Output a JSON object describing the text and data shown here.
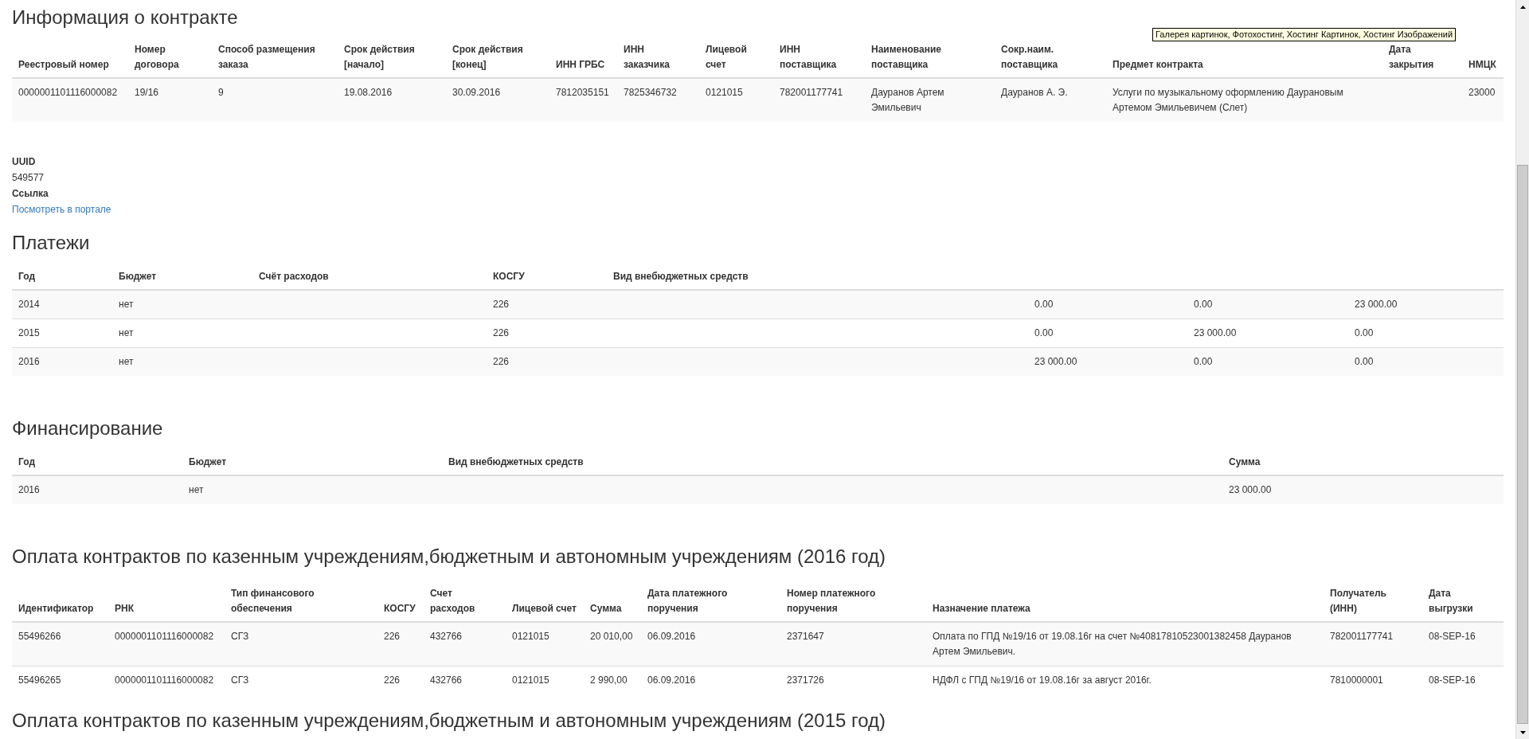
{
  "tooltip": {
    "text": "Галерея картинок, Фотохостинг, Хостинг Картинок, Хостинг Изображений"
  },
  "contract": {
    "title": "Информация о контракте",
    "columns": [
      "Реестровый номер",
      "Номер договора",
      "Способ размещения заказа",
      "Срок действия [начало]",
      "Срок действия [конец]",
      "ИНН ГРБС",
      "ИНН заказчика",
      "Лицевой счет",
      "ИНН поставщика",
      "Наименование поставщика",
      "Сокр.наим. поставщика",
      "Предмет контракта",
      "Дата закрытия",
      "НМЦК"
    ],
    "rows": [
      [
        "0000001101116000082",
        "19/16",
        "9",
        "19.08.2016",
        "30.09.2016",
        "7812035151",
        "7825346732",
        "0121015",
        "782001177741",
        "Дауранов Артем Эмильевич",
        "Дауранов А. Э.",
        "Услуги по музыкальному оформлению Даурановым Артемом Эмильевичем (Слет)",
        null,
        "23000"
      ]
    ]
  },
  "details": [
    {
      "label": "UUID",
      "value": "549577",
      "kind": "text"
    },
    {
      "label": "Ссылка",
      "value": "Посмотреть в портале",
      "kind": "link"
    }
  ],
  "payments": {
    "title": "Платежи",
    "columns": [
      "Год",
      "Бюджет",
      "Счёт расходов",
      "КОСГУ",
      "Вид внебюджетных средств"
    ],
    "rows": [
      [
        "2014",
        "нет",
        null,
        "226",
        null,
        "0.00",
        "0.00",
        "23 000.00"
      ],
      [
        "2015",
        "нет",
        null,
        "226",
        null,
        "0.00",
        "23 000.00",
        "0.00"
      ],
      [
        "2016",
        "нет",
        null,
        "226",
        null,
        "23 000.00",
        "0.00",
        "0.00"
      ]
    ]
  },
  "financing": {
    "title": "Финансирование",
    "columns": [
      "Год",
      "Бюджет",
      "Вид внебюджетных средств",
      "Сумма"
    ],
    "rows": [
      [
        "2016",
        "нет",
        null,
        "23 000.00"
      ]
    ]
  },
  "payments_2016": {
    "title": "Оплата контрактов по казенным учреждениям,бюджетным и автономным учреждениям (2016 год)",
    "columns": [
      "Идентификатор",
      "РНК",
      "Тип финансового обеспечения",
      "КОСГУ",
      "Счет расходов",
      "Лицевой счет",
      "Сумма",
      "Дата платежного поручения",
      "Номер платежного поручения",
      "Назначение платежа",
      "Получатель (ИНН)",
      "Дата выгрузки"
    ],
    "rows": [
      [
        "55496266",
        "0000001101116000082",
        "СГЗ",
        "226",
        "432766",
        "0121015",
        "20 010,00",
        "06.09.2016",
        "2371647",
        "Оплата по ГПД №19/16 от 19.08.16г на счет №40817810523001382458 Дауранов Артем Эмильевич.",
        "782001177741",
        "08-SEP-16"
      ],
      [
        "55496265",
        "0000001101116000082",
        "СГЗ",
        "226",
        "432766",
        "0121015",
        "2 990,00",
        "06.09.2016",
        "2371726",
        "НДФЛ с ГПД №19/16 от 19.08.16г за август 2016г.",
        "7810000001",
        "08-SEP-16"
      ]
    ]
  },
  "payments_2015": {
    "title": "Оплата контрактов по казенным учреждениям,бюджетным и автономным учреждениям (2015 год)"
  }
}
